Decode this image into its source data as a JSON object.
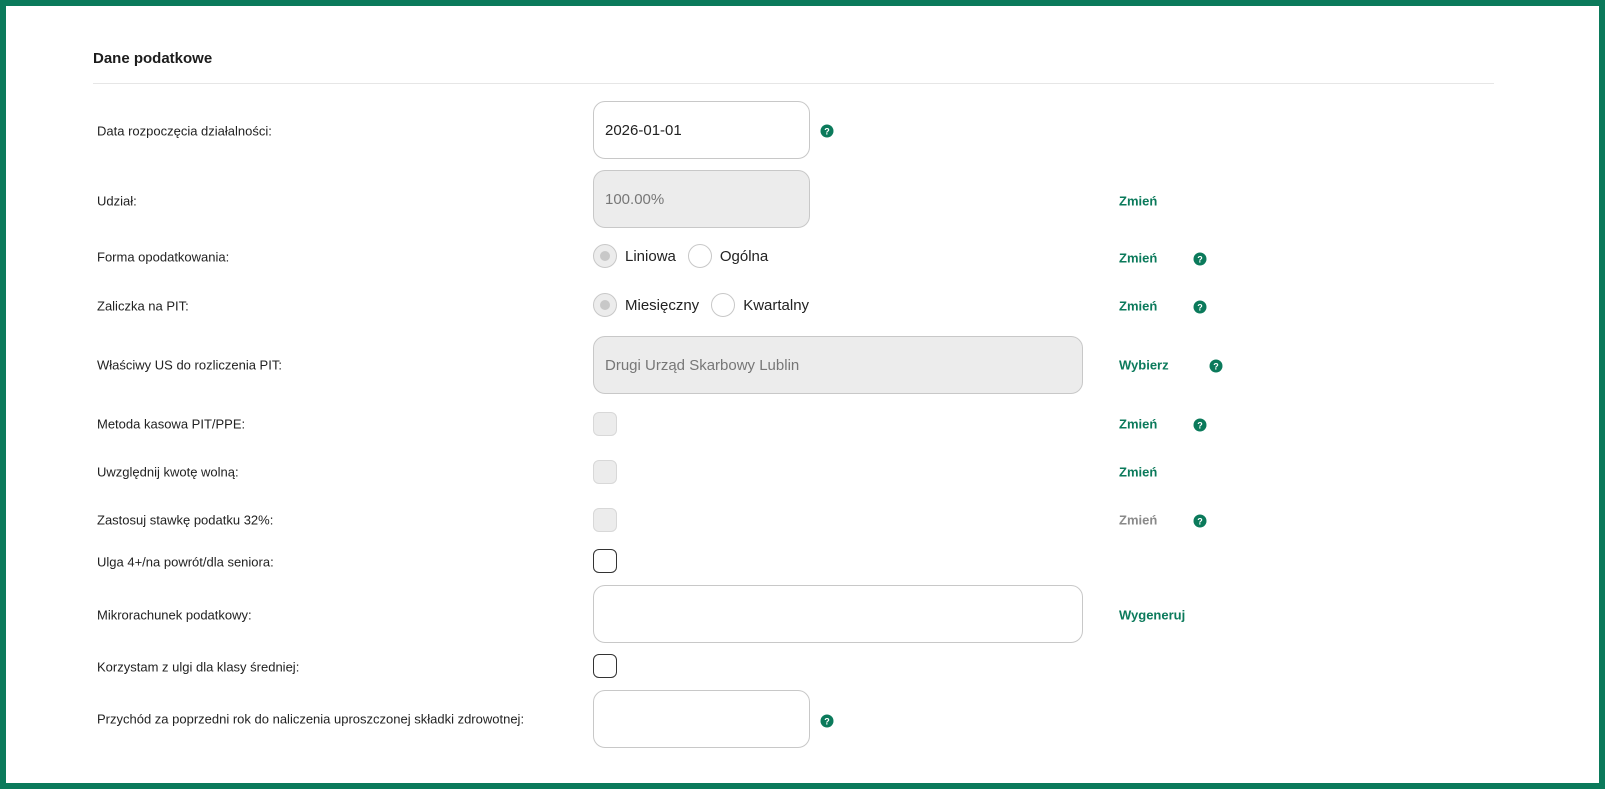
{
  "section": {
    "title": "Dane podatkowe"
  },
  "rows": {
    "start_date": {
      "label": "Data rozpoczęcia działalności:",
      "value": "2026-01-01",
      "help_icon": "question-icon"
    },
    "share": {
      "label": "Udział:",
      "value": "100.00%",
      "action": "Zmień"
    },
    "tax_form": {
      "label": "Forma opodatkowania:",
      "options": [
        "Liniowa",
        "Ogólna"
      ],
      "selected": "Liniowa",
      "action": "Zmień"
    },
    "pit_advance": {
      "label": "Zaliczka na PIT:",
      "options": [
        "Miesięczny",
        "Kwartalny"
      ],
      "selected": "Miesięczny",
      "action": "Zmień"
    },
    "tax_office": {
      "label": "Właściwy US do rozliczenia PIT:",
      "value": "Drugi Urząd Skarbowy Lublin",
      "action": "Wybierz"
    },
    "cash_method": {
      "label": "Metoda kasowa PIT/PPE:",
      "checked": false,
      "action": "Zmień"
    },
    "tax_free": {
      "label": "Uwzględnij kwotę wolną:",
      "checked": false,
      "action": "Zmień"
    },
    "rate_32": {
      "label": "Zastosuj stawkę podatku 32%:",
      "checked": false,
      "action": "Zmień"
    },
    "relief_4plus": {
      "label": "Ulga 4+/na powrót/dla seniora:",
      "checked": false
    },
    "micro_account": {
      "label": "Mikrorachunek podatkowy:",
      "value": "",
      "action": "Wygeneruj"
    },
    "middle_class": {
      "label": "Korzystam z ulgi dla klasy średniej:",
      "checked": false
    },
    "prev_year_income": {
      "label": "Przychód za poprzedni rok do naliczenia uproszczonej składki zdrowotnej:",
      "value": ""
    }
  },
  "help_glyph": "?",
  "colors": {
    "accent": "#0b7a5b",
    "disabled_bg": "#ececec",
    "border": "#c8c8c8"
  }
}
